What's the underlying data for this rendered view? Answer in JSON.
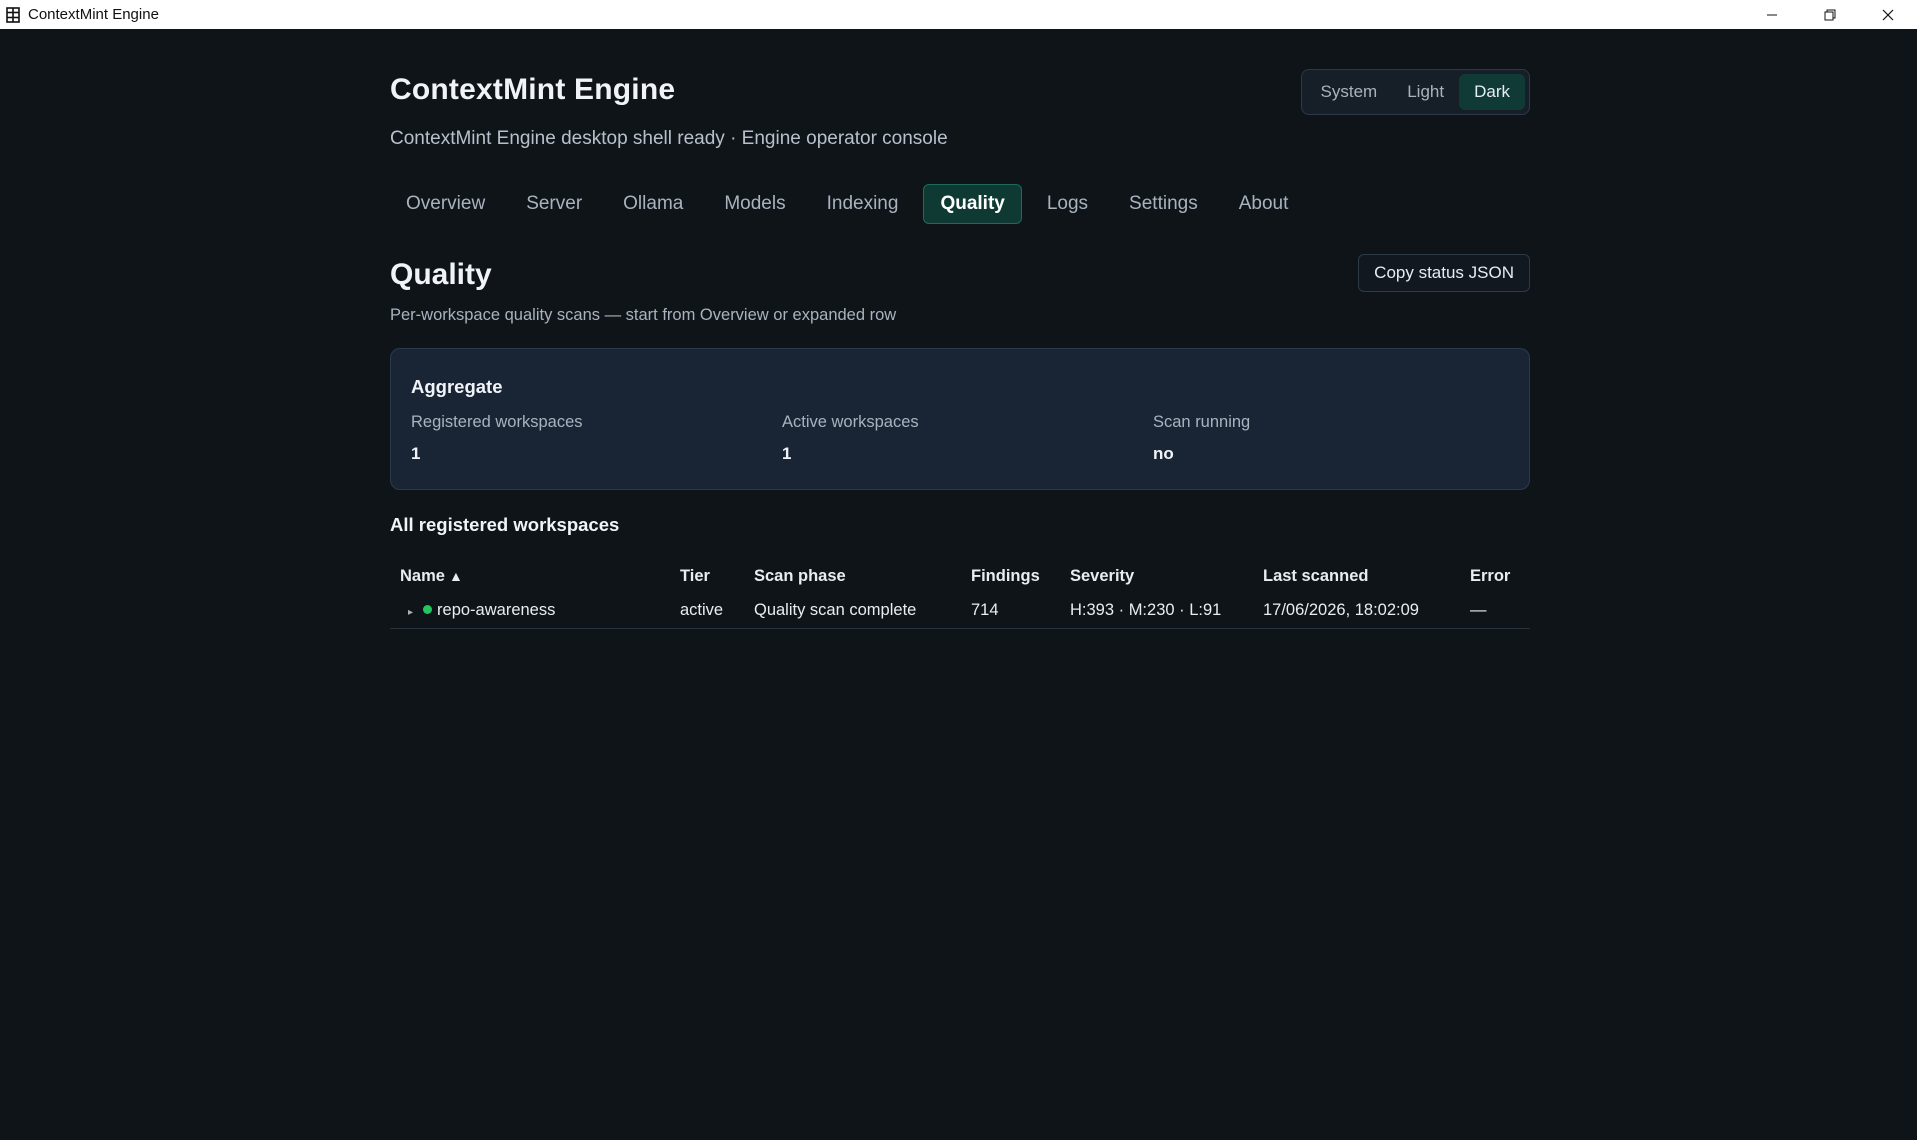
{
  "window": {
    "title": "ContextMint Engine"
  },
  "header": {
    "title": "ContextMint Engine",
    "subtitle": "ContextMint Engine desktop shell ready · Engine operator console"
  },
  "theme": {
    "options": [
      "System",
      "Light",
      "Dark"
    ],
    "selected": "Dark"
  },
  "tabs": [
    "Overview",
    "Server",
    "Ollama",
    "Models",
    "Indexing",
    "Quality",
    "Logs",
    "Settings",
    "About"
  ],
  "active_tab": "Quality",
  "section": {
    "title": "Quality",
    "subtitle": "Per-workspace quality scans — start from Overview or expanded row",
    "copy_button": "Copy status JSON"
  },
  "aggregate": {
    "title": "Aggregate",
    "items": [
      {
        "label": "Registered workspaces",
        "value": "1"
      },
      {
        "label": "Active workspaces",
        "value": "1"
      },
      {
        "label": "Scan running",
        "value": "no"
      }
    ]
  },
  "workspaces": {
    "heading": "All registered workspaces",
    "columns": [
      "Name",
      "Tier",
      "Scan phase",
      "Findings",
      "Severity",
      "Last scanned",
      "Error"
    ],
    "sort_indicator": "▲",
    "rows": [
      {
        "name": "repo-awareness",
        "tier": "active",
        "scan_phase": "Quality scan complete",
        "findings": "714",
        "severity": "H:393 · M:230 · L:91",
        "last_scanned": "17/06/2026, 18:02:09",
        "error": "—",
        "status_color": "#22c55e"
      }
    ]
  },
  "colors": {
    "background": "#0f1419",
    "accent": "#0f3a33",
    "status_ok": "#22c55e"
  }
}
